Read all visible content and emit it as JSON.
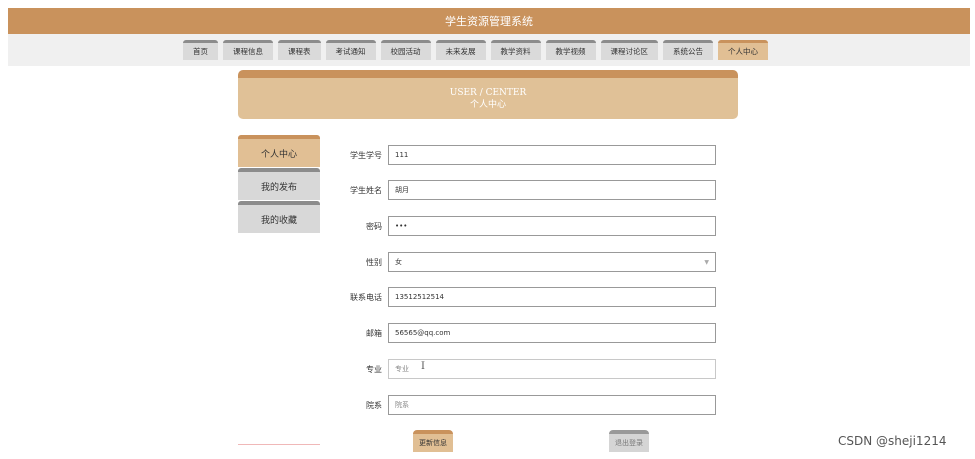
{
  "header": {
    "title": "学生资源管理系统"
  },
  "nav": {
    "items": [
      "首页",
      "课程信息",
      "课程表",
      "考试通知",
      "校园活动",
      "未来发展",
      "教学资料",
      "教学视频",
      "课程讨论区",
      "系统公告",
      "个人中心"
    ],
    "active": "个人中心"
  },
  "banner": {
    "en": "USER / CENTER",
    "cn": "个人中心"
  },
  "sidebar": {
    "items": [
      "个人中心",
      "我的发布",
      "我的收藏"
    ],
    "active": "个人中心"
  },
  "form": {
    "student_id": {
      "label": "学生学号",
      "value": "111"
    },
    "student_name": {
      "label": "学生姓名",
      "value": "胡月"
    },
    "password": {
      "label": "密码",
      "value": "•••"
    },
    "gender": {
      "label": "性别",
      "value": "女"
    },
    "phone": {
      "label": "联系电话",
      "value": "13512512514"
    },
    "email": {
      "label": "邮箱",
      "value": "56565@qq.com"
    },
    "major": {
      "label": "专业",
      "placeholder": "专业"
    },
    "department": {
      "label": "院系",
      "placeholder": "院系"
    }
  },
  "buttons": {
    "update": "更新信息",
    "logout": "退出登录"
  },
  "watermark": "CSDN @sheji1214",
  "colors": {
    "accent": "#c9925c",
    "accent_light": "#e1bf94",
    "banner": "#e0c197",
    "tab_gray": "#dadada"
  }
}
